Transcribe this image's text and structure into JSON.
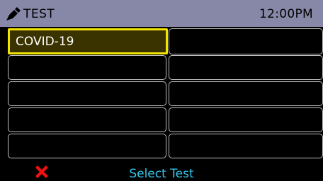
{
  "header": {
    "title": "TEST",
    "time": "12:00PM",
    "icon": "test-swab-icon",
    "background": "#8787a8"
  },
  "grid": {
    "cells": [
      {
        "label": "COVID-19",
        "selected": true
      },
      {
        "label": "",
        "selected": false
      },
      {
        "label": "",
        "selected": false
      },
      {
        "label": "",
        "selected": false
      },
      {
        "label": "",
        "selected": false
      },
      {
        "label": "",
        "selected": false
      },
      {
        "label": "",
        "selected": false
      },
      {
        "label": "",
        "selected": false
      },
      {
        "label": "",
        "selected": false
      },
      {
        "label": "",
        "selected": false
      }
    ],
    "selected_border": "#f3e300",
    "selected_fill": "#3a3300"
  },
  "footer": {
    "cancel_icon": "close-icon",
    "cancel_color": "#ee1111",
    "action_label": "Select Test",
    "action_color": "#33c6e6"
  }
}
